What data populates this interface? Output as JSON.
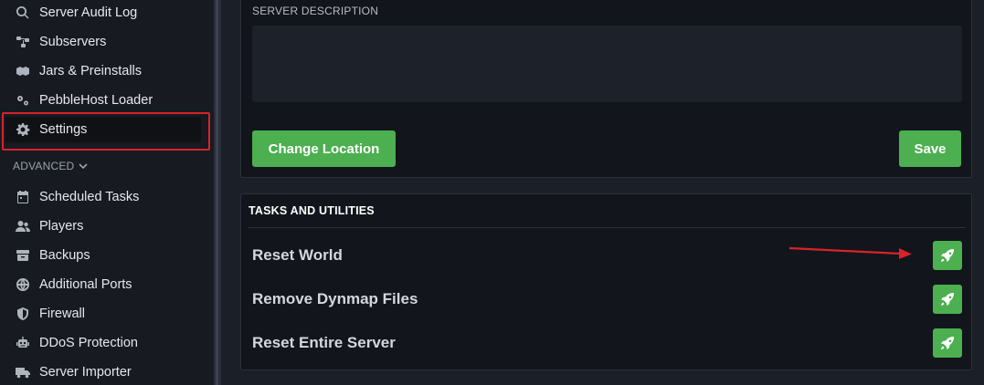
{
  "sidebar": {
    "items": [
      {
        "label": "Server Audit Log",
        "icon": "search-icon"
      },
      {
        "label": "Subservers",
        "icon": "network-icon"
      },
      {
        "label": "Jars & Preinstalls",
        "icon": "boxes-icon"
      },
      {
        "label": "PebbleHost Loader",
        "icon": "gears-icon"
      },
      {
        "label": "Settings",
        "icon": "gear-icon",
        "active": true
      }
    ],
    "advanced_header": "ADVANCED",
    "advanced_items": [
      {
        "label": "Scheduled Tasks",
        "icon": "calendar-icon"
      },
      {
        "label": "Players",
        "icon": "users-icon"
      },
      {
        "label": "Backups",
        "icon": "archive-icon"
      },
      {
        "label": "Additional Ports",
        "icon": "globe-icon"
      },
      {
        "label": "Firewall",
        "icon": "shield-icon"
      },
      {
        "label": "DDoS Protection",
        "icon": "robot-icon"
      },
      {
        "label": "Server Importer",
        "icon": "truck-icon"
      }
    ]
  },
  "description": {
    "label": "SERVER DESCRIPTION",
    "value": ""
  },
  "buttons": {
    "change_location": "Change Location",
    "save": "Save"
  },
  "tasks": {
    "title": "TASKS AND UTILITIES",
    "items": [
      {
        "label": "Reset World",
        "icon": "rocket-icon"
      },
      {
        "label": "Remove Dynmap Files",
        "icon": "rocket-icon"
      },
      {
        "label": "Reset Entire Server",
        "icon": "rocket-icon"
      }
    ]
  },
  "colors": {
    "accent_green": "#4caf50",
    "highlight_red": "#d8232a",
    "background": "#1b1f27",
    "panel": "#12151b"
  }
}
